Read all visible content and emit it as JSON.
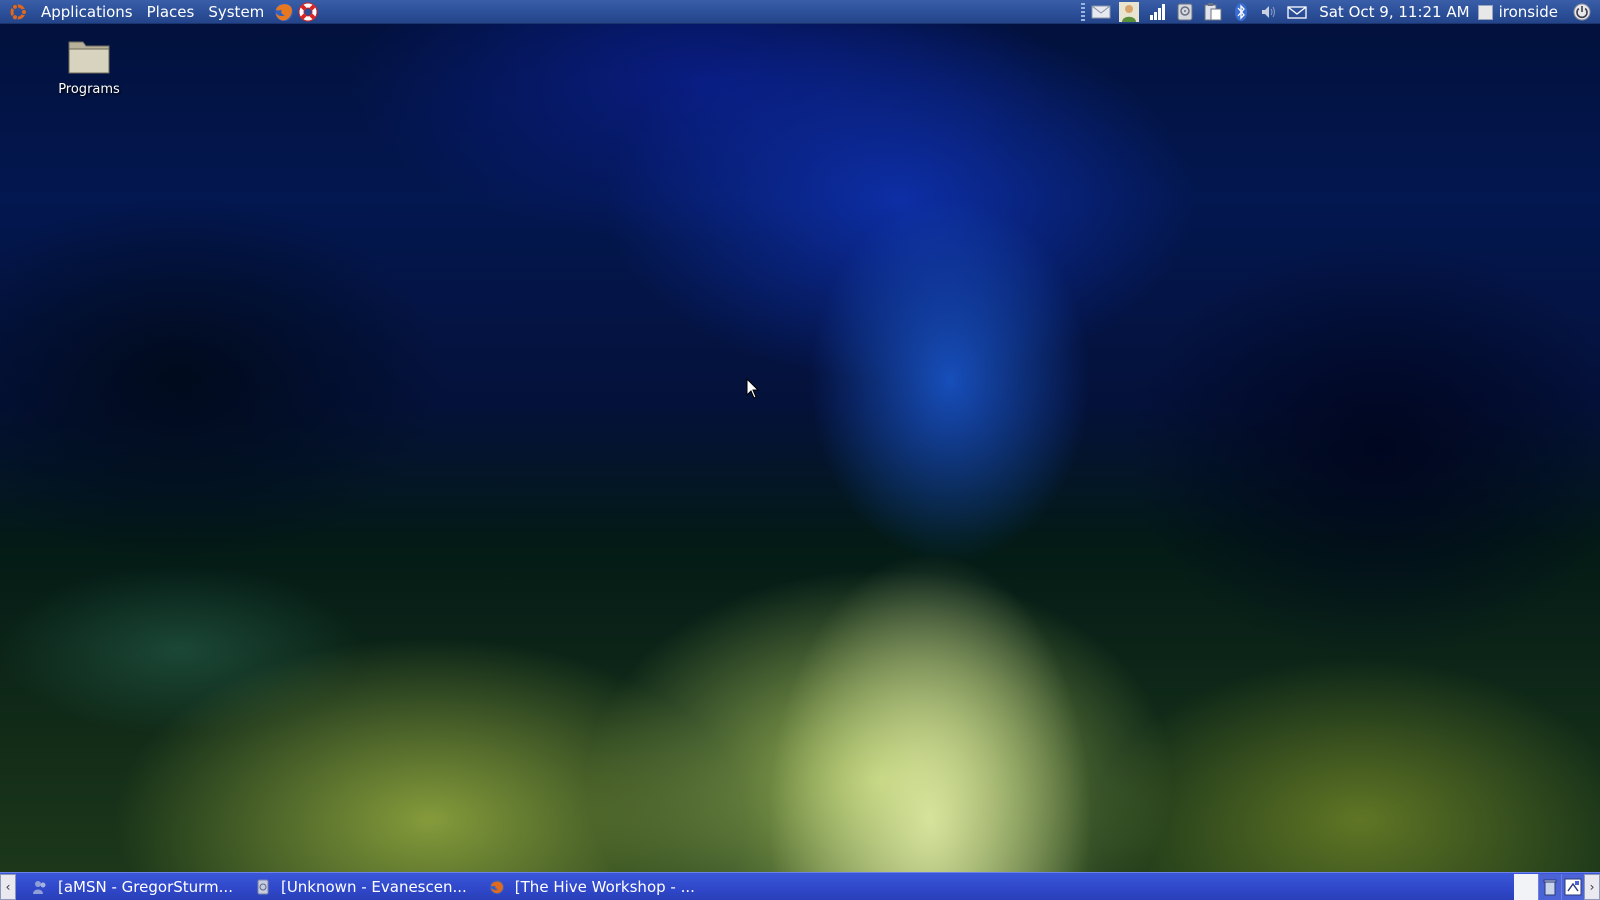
{
  "top_panel": {
    "menus": [
      "Applications",
      "Places",
      "System"
    ],
    "launchers": [
      "firefox-icon",
      "help-lifebuoy-icon"
    ],
    "tray_icons": [
      "mail-icon",
      "person-icon",
      "signal-bars-icon",
      "disc-icon",
      "clipboard-icon",
      "bluetooth-icon",
      "volume-icon",
      "envelope-icon"
    ],
    "clock": "Sat Oct  9, 11:21 AM",
    "username": "ironside"
  },
  "desktop": {
    "icons": [
      {
        "label": "Programs",
        "icon": "folder-icon"
      }
    ]
  },
  "bottom_panel": {
    "tasks": [
      {
        "label": "[aMSN - GregorSturm...",
        "icon": "amsn-icon"
      },
      {
        "label": "[Unknown - Evanescen...",
        "icon": "media-player-icon"
      },
      {
        "label": "[The Hive Workshop - ...",
        "icon": "firefox-icon"
      }
    ],
    "right_buttons": [
      "trash-icon",
      "workspace-switcher-icon"
    ]
  },
  "colors": {
    "top_panel": "#2b4f99",
    "bottom_panel": "#2f47c9"
  }
}
